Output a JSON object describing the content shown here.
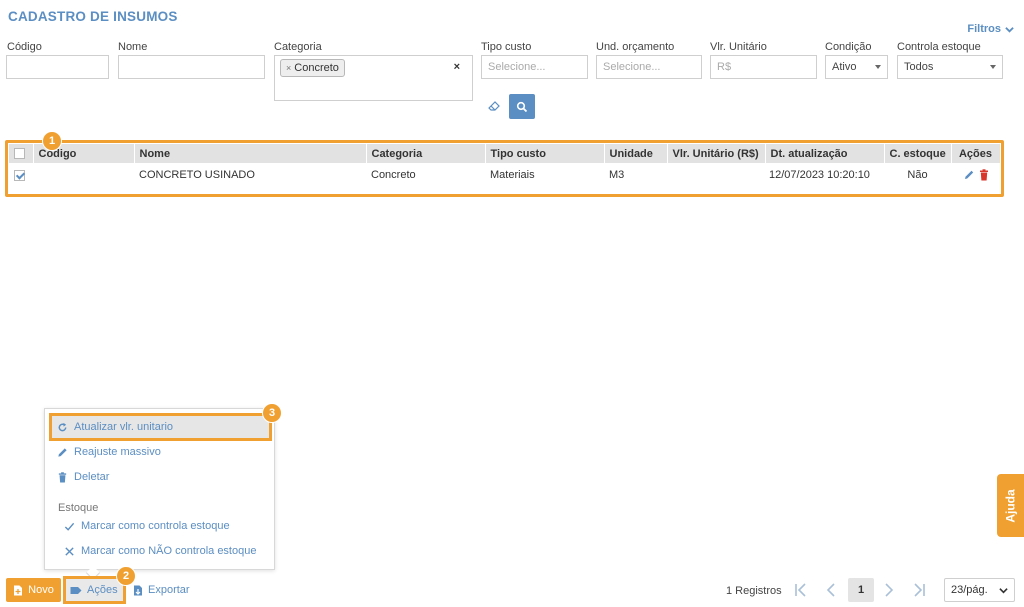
{
  "page": {
    "title": "CADASTRO DE INSUMOS",
    "filters_toggle": "Filtros"
  },
  "filters": {
    "codigo": {
      "label": "Código",
      "value": ""
    },
    "nome": {
      "label": "Nome",
      "value": ""
    },
    "categoria": {
      "label": "Categoria",
      "tag": "Concreto",
      "tag_remove": "×",
      "clear": "×"
    },
    "tipo_custo": {
      "label": "Tipo custo",
      "placeholder": "Selecione..."
    },
    "und_orcamento": {
      "label": "Und. orçamento",
      "placeholder": "Selecione..."
    },
    "vlr_unitario": {
      "label": "Vlr. Unitário",
      "placeholder": "R$"
    },
    "condicao": {
      "label": "Condição",
      "value": "Ativo"
    },
    "controla_estoque": {
      "label": "Controla estoque",
      "value": "Todos"
    }
  },
  "grid": {
    "columns": [
      "Código",
      "Nome",
      "Categoria",
      "Tipo custo",
      "Unidade",
      "Vlr. Unitário (R$)",
      "Dt. atualização",
      "C. estoque",
      "Ações"
    ],
    "rows": [
      {
        "codigo": "",
        "nome": "CONCRETO USINADO",
        "categoria": "Concreto",
        "tipo_custo": "Materiais",
        "unidade": "M3",
        "vlr_unitario": "",
        "dt_atualizacao": "12/07/2023 10:20:10",
        "c_estoque": "Não",
        "checked": true
      }
    ]
  },
  "badges": [
    "1",
    "2",
    "3"
  ],
  "actions_menu": {
    "items": [
      {
        "label": "Atualizar vlr. unitario",
        "icon": "refresh-icon"
      },
      {
        "label": "Reajuste massivo",
        "icon": "pencil-icon"
      },
      {
        "label": "Deletar",
        "icon": "trash-icon"
      }
    ],
    "section_label": "Estoque",
    "stock_items": [
      {
        "label": "Marcar como controla estoque",
        "icon": "check-icon"
      },
      {
        "label": "Marcar como NÃO controla estoque",
        "icon": "x-icon"
      }
    ]
  },
  "toolbar": {
    "novo": "Novo",
    "acoes": "Ações",
    "exportar": "Exportar"
  },
  "pagination": {
    "records": "1 Registros",
    "current_page": "1",
    "page_size": "23/pág."
  },
  "help": {
    "label": "Ajuda"
  },
  "colors": {
    "accent": "#5b8ec2",
    "highlight": "#f0a030",
    "danger": "#d9362b"
  }
}
